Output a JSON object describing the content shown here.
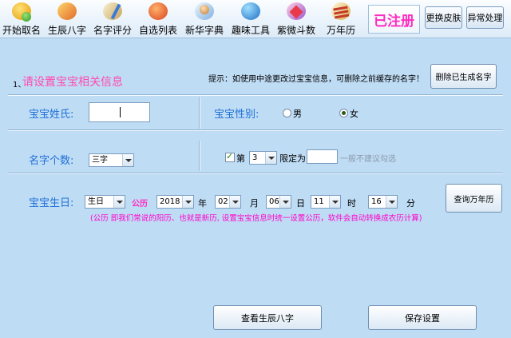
{
  "toolbar": {
    "items": [
      {
        "label": "开始取名",
        "icon": "baby-icon"
      },
      {
        "label": "生辰八字",
        "icon": "bagua-icon"
      },
      {
        "label": "名字评分",
        "icon": "score-pen-icon"
      },
      {
        "label": "自选列表",
        "icon": "list-icon"
      },
      {
        "label": "新华字典",
        "icon": "dictionary-icon"
      },
      {
        "label": "趣味工具",
        "icon": "globe-icon"
      },
      {
        "label": "紫微斗数",
        "icon": "star-chart-icon"
      },
      {
        "label": "万年历",
        "icon": "calendar-icon"
      }
    ],
    "registered": "已注册",
    "skin_button": "更换皮肤",
    "error_button": "异常处理"
  },
  "header": {
    "number": "1、",
    "title": "请设置宝宝相关信息",
    "tip": "提示：如使用中途更改过宝宝信息，可删除之前缓存的名字！",
    "delete_button": "删除已生成名字"
  },
  "surname": {
    "label": "宝宝姓氏:",
    "value": ""
  },
  "gender": {
    "label": "宝宝性别:",
    "options": [
      "男",
      "女"
    ],
    "selected": "女"
  },
  "name_count": {
    "label": "名字个数:",
    "value": "三字"
  },
  "limit": {
    "checked": true,
    "prefix": "第",
    "position": "3",
    "limit_label": "限定为",
    "limit_value": "",
    "hint": "一般不建议勾选"
  },
  "birthday": {
    "label": "宝宝生日:",
    "type": "生日",
    "calendar": "公历",
    "year": "2018",
    "year_unit": "年",
    "month": "02",
    "month_unit": "月",
    "day": "06",
    "day_unit": "日",
    "hour": "11",
    "hour_unit": "时",
    "minute": "16",
    "minute_unit": "分",
    "note": "(公历   即我们常说的阳历、也就是新历, 设置宝宝信息时统一设置公历，软件会自动转换成农历计算)",
    "perpetual_button": "查询万年历"
  },
  "actions": {
    "view_bazi": "查看生辰八字",
    "save": "保存设置"
  }
}
